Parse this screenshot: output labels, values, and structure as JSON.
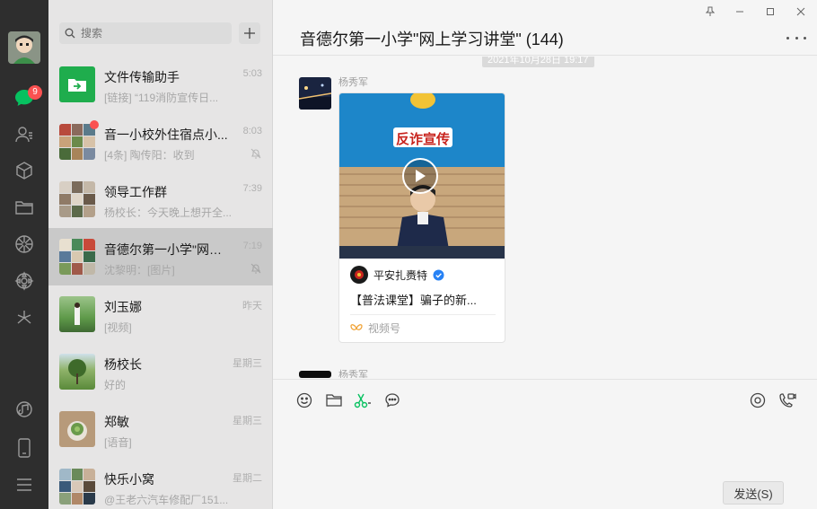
{
  "nav": {
    "chat_badge": "9"
  },
  "search": {
    "placeholder": "搜索"
  },
  "chats": [
    {
      "name": "文件传输助手",
      "time": "5:03",
      "preview": "[链接] “119消防宣传日...",
      "muted": false
    },
    {
      "name": "音一小校外住宿点小...",
      "time": "8:03",
      "preview": "[4条] 陶传阳：收到",
      "muted": true,
      "unread_dot": true
    },
    {
      "name": "领导工作群",
      "time": "7:39",
      "preview": "杨校长：今天晚上想开全...",
      "muted": false
    },
    {
      "name": "音德尔第一小学\"网上...",
      "time": "7:19",
      "preview": "沈黎明：[图片]",
      "muted": true,
      "active": true
    },
    {
      "name": "刘玉娜",
      "time": "昨天",
      "preview": "[视频]",
      "muted": false
    },
    {
      "name": "杨校长",
      "time": "星期三",
      "preview": "好的",
      "muted": false
    },
    {
      "name": "郑敏",
      "time": "星期三",
      "preview": "[语音]",
      "muted": false
    },
    {
      "name": "快乐小窝",
      "time": "星期二",
      "preview": "@王老六汽车修配厂151...",
      "muted": false
    }
  ],
  "chat": {
    "title": "音德尔第一小学\"网上学习讲堂\" (144)",
    "timestamp": "2021年10月28日 19:17",
    "messages": [
      {
        "sender": "杨秀军",
        "type": "channels-video",
        "video_banner": "反诈宣传",
        "channel_name": "平安扎赉特",
        "description": "【普法课堂】骗子的新...",
        "footer": "视频号"
      },
      {
        "sender": "杨秀军"
      }
    ]
  },
  "composer": {
    "send_label": "发送(S)"
  },
  "colors": {
    "accent": "#07c160",
    "badge": "#fa5151",
    "nav_bg": "#2e2e2e",
    "verified": "#2782f5"
  }
}
